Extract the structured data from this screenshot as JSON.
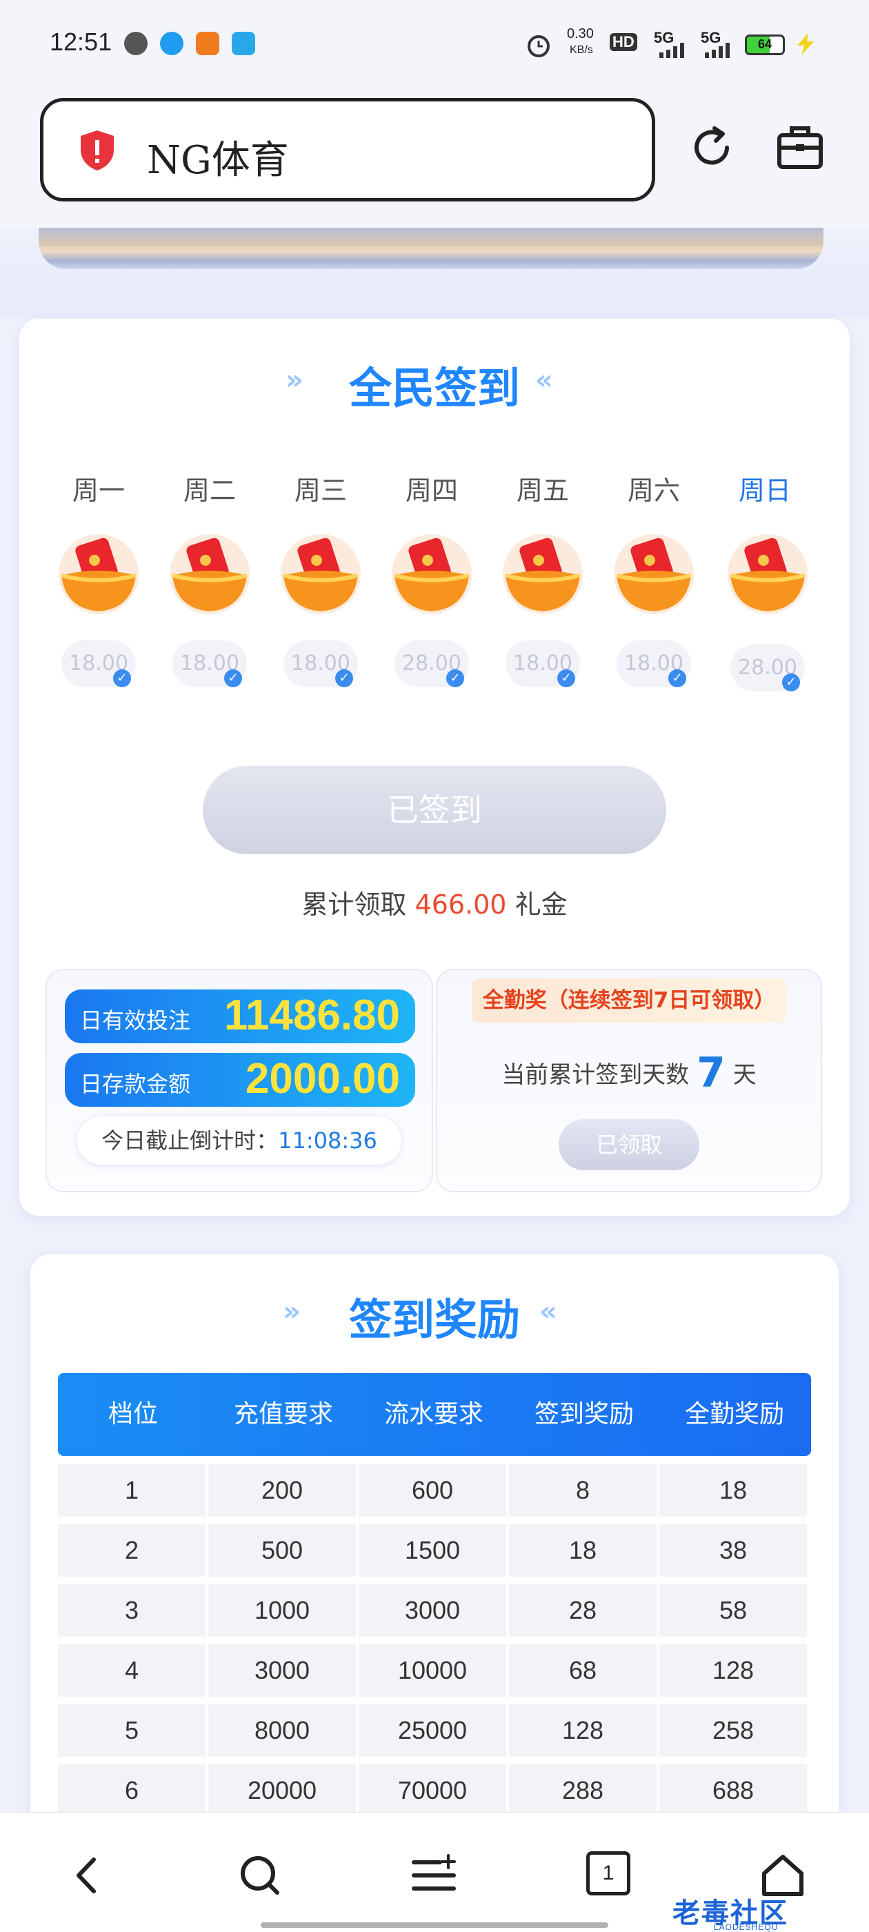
{
  "status_bar": {
    "time": "12:51",
    "net_speed": "0.30",
    "net_unit": "KB/s",
    "hd": "HD",
    "net1": "5G",
    "net2": "5G",
    "battery": "64",
    "battery_level": 0.64
  },
  "browser": {
    "url_text": "NG体育"
  },
  "signin": {
    "title": "全民签到",
    "days": [
      {
        "label": "周一",
        "amount": "18.00"
      },
      {
        "label": "周二",
        "amount": "18.00"
      },
      {
        "label": "周三",
        "amount": "18.00"
      },
      {
        "label": "周四",
        "amount": "28.00"
      },
      {
        "label": "周五",
        "amount": "18.00"
      },
      {
        "label": "周六",
        "amount": "18.00"
      },
      {
        "label": "周日",
        "amount": "28.00"
      }
    ],
    "signed_button": "已签到",
    "accum_prefix": "累计领取",
    "accum_value": "466.00",
    "accum_suffix": "礼金"
  },
  "stats": {
    "bet_label": "日有效投注",
    "bet_value": "11486.80",
    "deposit_label": "日存款金额",
    "deposit_value": "2000.00",
    "countdown_label": "今日截止倒计时：",
    "countdown_value": "11:08:36"
  },
  "full_attendance": {
    "tag": "全勤奖（连续签到7日可领取）",
    "days_prefix": "当前累计签到天数",
    "days_value": "7",
    "days_suffix": "天",
    "received_button": "已领取"
  },
  "rewards": {
    "title": "签到奖励",
    "headers": [
      "档位",
      "充值要求",
      "流水要求",
      "签到奖励",
      "全勤奖励"
    ],
    "rows": [
      [
        "1",
        "200",
        "600",
        "8",
        "18"
      ],
      [
        "2",
        "500",
        "1500",
        "18",
        "38"
      ],
      [
        "3",
        "1000",
        "3000",
        "28",
        "58"
      ],
      [
        "4",
        "3000",
        "10000",
        "68",
        "128"
      ],
      [
        "5",
        "8000",
        "25000",
        "128",
        "258"
      ],
      [
        "6",
        "20000",
        "70000",
        "288",
        "688"
      ]
    ]
  },
  "bottom_nav": {
    "tab_count": "1"
  },
  "watermark": {
    "text": "老毒社区",
    "sub": "LAODESHEQU"
  }
}
